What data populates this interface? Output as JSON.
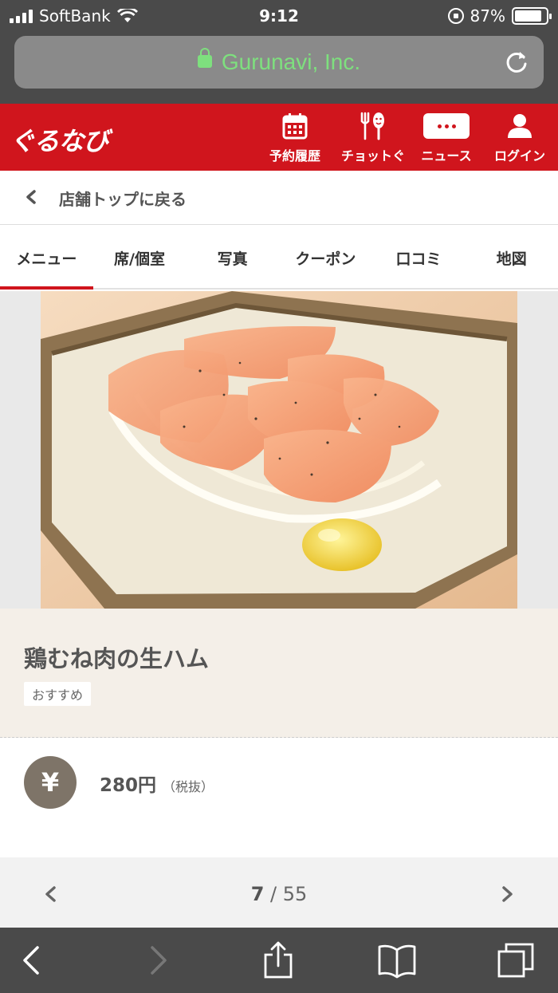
{
  "status_bar": {
    "carrier": "SoftBank",
    "time": "9:12",
    "battery": "87%",
    "battery_level": 0.87
  },
  "url_bar": {
    "site": "Gurunavi, Inc."
  },
  "header": {
    "logo": "ぐるなび",
    "nav": [
      {
        "label": "予約履歴",
        "icon": "calendar-icon"
      },
      {
        "label": "チョットぐ",
        "icon": "fork-spoon-icon"
      },
      {
        "label": "ニュース",
        "icon": "more-dots-icon"
      },
      {
        "label": "ログイン",
        "icon": "user-icon"
      }
    ]
  },
  "back": {
    "label": "店舗トップに戻る"
  },
  "tabs": [
    {
      "label": "メニュー",
      "active": true
    },
    {
      "label": "席/個室",
      "active": false
    },
    {
      "label": "写真",
      "active": false
    },
    {
      "label": "クーポン",
      "active": false
    },
    {
      "label": "口コミ",
      "active": false
    },
    {
      "label": "地図",
      "active": false
    }
  ],
  "dish": {
    "name": "鶏むね肉の生ハム",
    "tag": "おすすめ",
    "price": "280円",
    "tax_note": "（税抜）",
    "currency_symbol": "¥"
  },
  "pager": {
    "current": "7",
    "separator": " / ",
    "total": "55"
  },
  "colors": {
    "brand_red": "#d0151d",
    "ios_bar": "#4a4a4a",
    "url_green": "#7ee07e",
    "info_bg": "#f4efe8",
    "yen_circle": "#7e7468"
  }
}
